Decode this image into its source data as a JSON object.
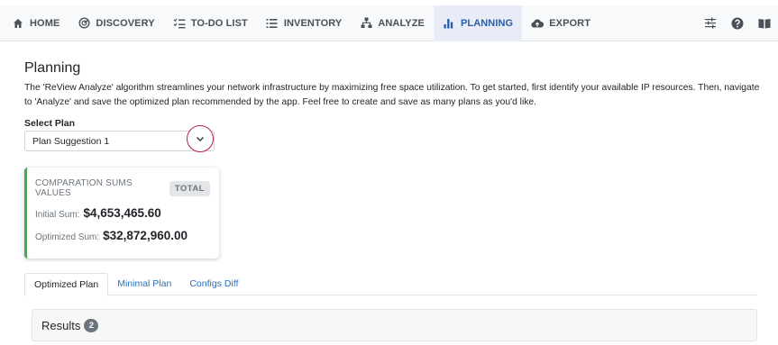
{
  "nav": {
    "items": [
      {
        "label": "HOME",
        "icon": "home-icon"
      },
      {
        "label": "DISCOVERY",
        "icon": "radar-icon"
      },
      {
        "label": "TO-DO LIST",
        "icon": "checklist-icon"
      },
      {
        "label": "INVENTORY",
        "icon": "list-icon"
      },
      {
        "label": "ANALYZE",
        "icon": "network-icon"
      },
      {
        "label": "PLANNING",
        "icon": "bar-chart-icon",
        "active": true
      },
      {
        "label": "EXPORT",
        "icon": "cloud-upload-icon"
      }
    ],
    "right_icons": [
      "sliders-icon",
      "help-icon",
      "book-icon"
    ],
    "active_color": "#2b5ca8"
  },
  "page": {
    "title": "Planning",
    "description": "The 'ReView Analyze' algorithm streamlines your network infrastructure by maximizing free space utilization. To get started, first identify your available IP resources. Then, navigate to 'Analyze' and save the optimized plan recommended by the app. Feel free to create and save as many plans as you'd like."
  },
  "plan_select": {
    "label": "Select Plan",
    "value": "Plan Suggestion 1"
  },
  "sums_card": {
    "title": "COMPARATION SUMS VALUES",
    "badge": "TOTAL",
    "initial_label": "Initial Sum:",
    "initial_value": "$4,653,465.60",
    "optimized_label": "Optimized Sum:",
    "optimized_value": "$32,872,960.00",
    "accent_color": "#3cb04b"
  },
  "tabs": [
    {
      "label": "Optimized Plan",
      "active": true
    },
    {
      "label": "Minimal Plan",
      "active": false
    },
    {
      "label": "Configs Diff",
      "active": false
    }
  ],
  "results": {
    "title": "Results",
    "count": "2"
  }
}
